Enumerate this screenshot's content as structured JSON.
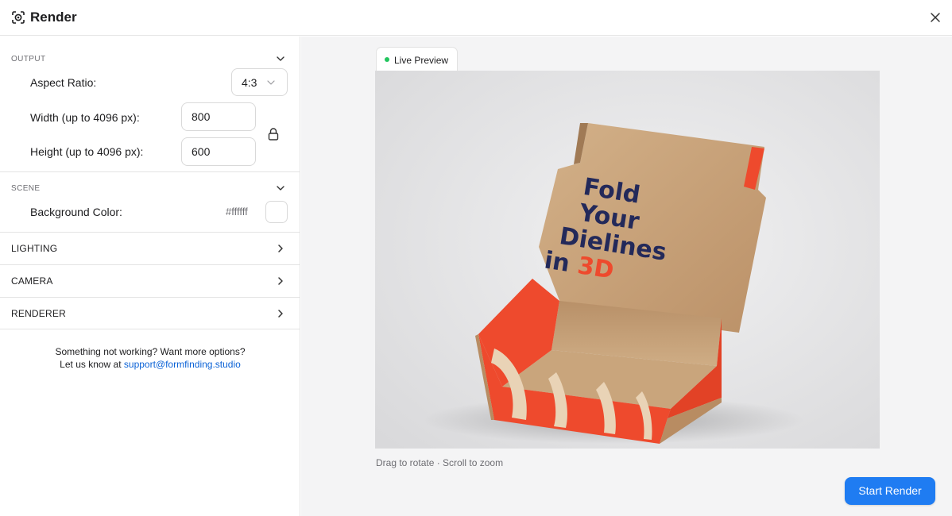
{
  "window": {
    "title": "Render",
    "icon": "render-camera-icon",
    "close_icon": "close-icon"
  },
  "output": {
    "section_label": "OUTPUT",
    "aspect_ratio": {
      "label": "Aspect Ratio:",
      "value": "4:3"
    },
    "width": {
      "label": "Width (up to 4096 px):",
      "value": "800"
    },
    "height": {
      "label": "Height (up to 4096 px):",
      "value": "600"
    },
    "lock_icon": "lock-icon"
  },
  "scene": {
    "section_label": "SCENE",
    "background_color": {
      "label": "Background Color:",
      "value": "#ffffff",
      "swatch": "#ffffff"
    }
  },
  "collapsed_sections": [
    {
      "label": "LIGHTING"
    },
    {
      "label": "CAMERA"
    },
    {
      "label": "RENDERER"
    }
  ],
  "help": {
    "line1": "Something not working? Want more options?",
    "line2_prefix": "Let us know at ",
    "email": "support@formfinding.studio"
  },
  "preview": {
    "tab_label": "Live Preview",
    "status_color": "#22c55e",
    "box_text_lines": [
      "Fold",
      "Your",
      "Dielines",
      "in"
    ],
    "box_text_accent": "3D",
    "hint": "Drag to rotate · Scroll to zoom"
  },
  "actions": {
    "start_render": "Start Render"
  },
  "colors": {
    "accent": "#1f7cf2",
    "link": "#0b62d6",
    "box_orange": "#ee4a2d",
    "box_cardboard": "#c9a57c",
    "text_navy": "#23295a"
  }
}
